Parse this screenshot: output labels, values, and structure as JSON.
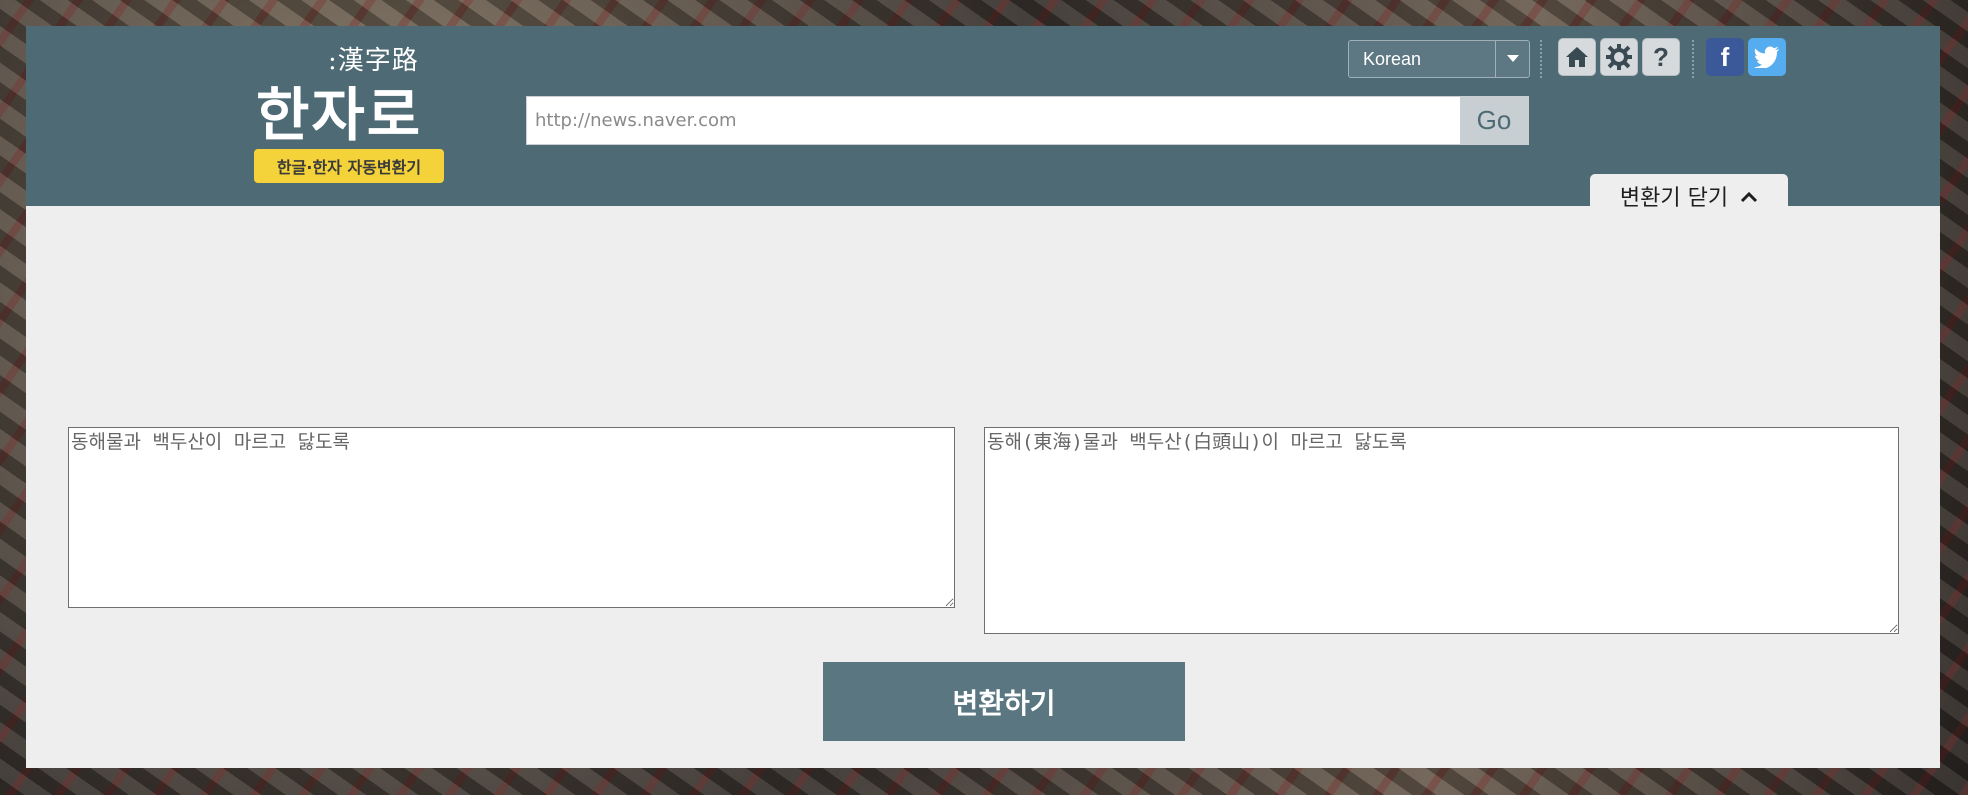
{
  "logo": {
    "hanja": ":漢字路",
    "title": "한자로",
    "badge": "한글·한자 자동변환기"
  },
  "url_bar": {
    "placeholder": "http://news.naver.com",
    "value": "",
    "go_label": "Go"
  },
  "language": {
    "selected": "Korean"
  },
  "icons": {
    "home": "home-icon",
    "settings": "gear-icon",
    "help": "help-icon",
    "facebook": "facebook-icon",
    "twitter": "twitter-icon",
    "help_glyph": "?",
    "facebook_glyph": "f"
  },
  "toggle": {
    "label": "변환기 닫기"
  },
  "input_text": "동해물과 백두산이 마르고 닳도록",
  "output_text": "동해(東海)물과 백두산(白頭山)이 마르고 닳도록",
  "convert_label": "변환하기",
  "colors": {
    "header": "#4e6a74",
    "badge": "#f4d23a",
    "button": "#5a7681",
    "panel": "#eeeeee"
  }
}
